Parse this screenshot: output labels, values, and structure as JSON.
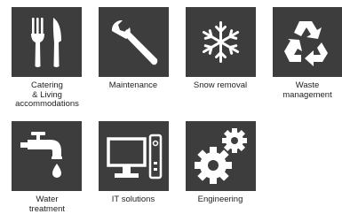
{
  "colors": {
    "tile_bg": "#3d3d3d",
    "icon": "#ffffff",
    "text": "#1e1e1e"
  },
  "services": [
    {
      "icon": "fork-knife-icon",
      "label_lines": [
        "Catering",
        "& Living",
        "accommodations"
      ]
    },
    {
      "icon": "wrench-icon",
      "label_lines": [
        "Maintenance"
      ]
    },
    {
      "icon": "snowflake-icon",
      "label_lines": [
        "Snow removal"
      ]
    },
    {
      "icon": "recycle-icon",
      "label_lines": [
        "Waste",
        "management"
      ]
    },
    {
      "icon": "water-tap-icon",
      "label_lines": [
        "Water",
        "treatment"
      ]
    },
    {
      "icon": "computer-icon",
      "label_lines": [
        "IT solutions"
      ]
    },
    {
      "icon": "gears-icon",
      "label_lines": [
        "Engineering"
      ]
    }
  ]
}
